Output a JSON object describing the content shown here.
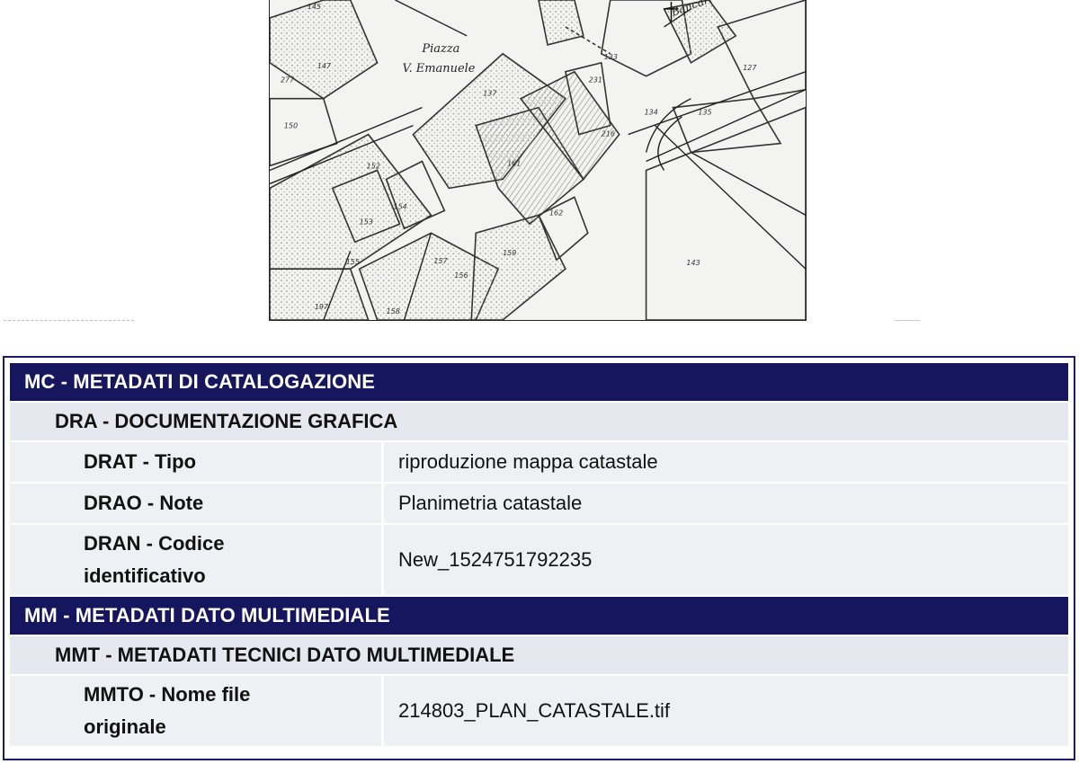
{
  "map": {
    "labels": {
      "piazza_line1": "Piazza",
      "piazza_line2": "V. Emanuele",
      "street_bancari": "Bancari",
      "parcel_145": "145",
      "parcel_147": "147",
      "parcel_150": "150",
      "parcel_152": "152",
      "parcel_153": "153",
      "parcel_154": "154",
      "parcel_156": "156",
      "parcel_157": "157",
      "parcel_158": "158",
      "parcel_159": "159",
      "parcel_161": "161",
      "parcel_162": "162",
      "parcel_133": "133",
      "parcel_134": "134",
      "parcel_135": "135",
      "parcel_127": "127",
      "parcel_143": "143",
      "parcel_137": "137",
      "parcel_216": "216",
      "parcel_231": "231",
      "parcel_155": "155",
      "parcel_197": "197",
      "parcel_277": "277"
    }
  },
  "sections": [
    {
      "title": "MC - METADATI DI CATALOGAZIONE",
      "subtitle": "DRA - DOCUMENTAZIONE GRAFICA",
      "rows": [
        {
          "key": "DRAT - Tipo",
          "value": "riproduzione mappa catastale"
        },
        {
          "key": "DRAO - Note",
          "value": "Planimetria catastale"
        },
        {
          "key_line1": "DRAN - Codice",
          "key_line2": "identificativo",
          "value": "New_1524751792235"
        }
      ]
    },
    {
      "title": "MM - METADATI DATO MULTIMEDIALE",
      "subtitle": "MMT - METADATI TECNICI DATO MULTIMEDIALE",
      "rows": [
        {
          "key_line1": "MMTO - Nome file",
          "key_line2": "originale",
          "value": "214803_PLAN_CATASTALE.tif"
        }
      ]
    }
  ],
  "colors": {
    "section_header_bg": "#16165f",
    "subsection_bg": "#e6e8f0",
    "row_bg": "#eff0f4",
    "frame_border": "#1b1d6a"
  }
}
